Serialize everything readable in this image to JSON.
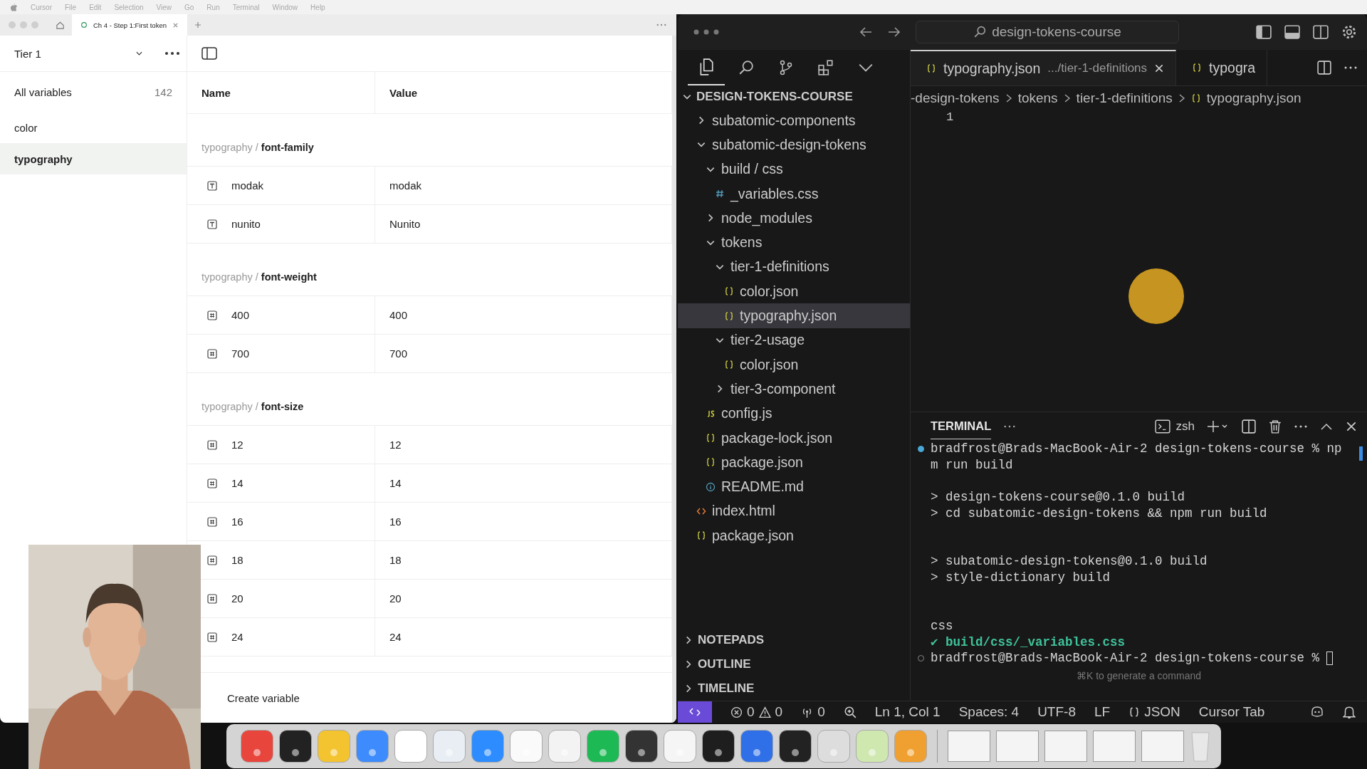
{
  "menu_bar": {
    "items": [
      "Cursor",
      "File",
      "Edit",
      "Selection",
      "View",
      "Go",
      "Run",
      "Terminal",
      "Window",
      "Help"
    ]
  },
  "variables_window": {
    "tab": {
      "title": "Ch 4 - Step 1:First token"
    },
    "collection": "Tier 1",
    "sidebar": {
      "all": {
        "label": "All variables",
        "count": "142"
      },
      "groups": [
        {
          "label": "color",
          "selected": false
        },
        {
          "label": "typography",
          "selected": true
        }
      ]
    },
    "columns": [
      "Name",
      "Value"
    ],
    "sections": [
      {
        "path": "typography /",
        "name": "font-family",
        "rows": [
          {
            "kind": "string",
            "name": "modak",
            "value": "modak"
          },
          {
            "kind": "string",
            "name": "nunito",
            "value": "Nunito"
          }
        ]
      },
      {
        "path": "typography /",
        "name": "font-weight",
        "rows": [
          {
            "kind": "number",
            "name": "400",
            "value": "400"
          },
          {
            "kind": "number",
            "name": "700",
            "value": "700"
          }
        ]
      },
      {
        "path": "typography /",
        "name": "font-size",
        "rows": [
          {
            "kind": "number",
            "name": "12",
            "value": "12"
          },
          {
            "kind": "number",
            "name": "14",
            "value": "14"
          },
          {
            "kind": "number",
            "name": "16",
            "value": "16"
          },
          {
            "kind": "number",
            "name": "18",
            "value": "18"
          },
          {
            "kind": "number",
            "name": "20",
            "value": "20"
          },
          {
            "kind": "number",
            "name": "24",
            "value": "24"
          }
        ]
      }
    ],
    "create_label": "Create variable"
  },
  "code_window": {
    "search": "design-tokens-course",
    "tabs": [
      {
        "label": "typography.json",
        "detail": ".../tier-1-definitions",
        "selected": true
      },
      {
        "label": "typogra",
        "selected": false
      }
    ],
    "breadcrumbs": [
      "-design-tokens",
      "tokens",
      "tier-1-definitions",
      "typography.json"
    ],
    "line_numbers": [
      "1"
    ],
    "explorer": {
      "title": "DESIGN-TOKENS-COURSE",
      "expanded": true,
      "items": [
        {
          "kind": "folder",
          "label": "subatomic-components",
          "expanded": false,
          "selected": false
        },
        {
          "kind": "folder",
          "label": "subatomic-design-tokens",
          "expanded": true,
          "selected": false,
          "children": [
            {
              "kind": "folder",
              "label": "build / css",
              "expanded": true,
              "selected": false,
              "children": [
                {
                  "kind": "css",
                  "label": "_variables.css",
                  "selected": false
                }
              ]
            },
            {
              "kind": "folder",
              "label": "node_modules",
              "expanded": false,
              "selected": false
            },
            {
              "kind": "folder",
              "label": "tokens",
              "expanded": true,
              "selected": false,
              "children": [
                {
                  "kind": "folder",
                  "label": "tier-1-definitions",
                  "expanded": true,
                  "selected": false,
                  "children": [
                    {
                      "kind": "json",
                      "label": "color.json",
                      "selected": false
                    },
                    {
                      "kind": "json",
                      "label": "typography.json",
                      "selected": true
                    }
                  ]
                },
                {
                  "kind": "folder",
                  "label": "tier-2-usage",
                  "expanded": true,
                  "selected": false,
                  "children": [
                    {
                      "kind": "json",
                      "label": "color.json",
                      "selected": false
                    }
                  ]
                },
                {
                  "kind": "folder",
                  "label": "tier-3-component",
                  "expanded": false,
                  "selected": false
                }
              ]
            },
            {
              "kind": "js",
              "label": "config.js",
              "selected": false
            },
            {
              "kind": "json",
              "label": "package-lock.json",
              "selected": false
            },
            {
              "kind": "json",
              "label": "package.json",
              "selected": false
            },
            {
              "kind": "info",
              "label": "README.md",
              "selected": false
            }
          ]
        },
        {
          "kind": "html",
          "label": "index.html",
          "selected": false
        },
        {
          "kind": "json",
          "label": "package.json",
          "selected": false
        }
      ]
    },
    "panels": [
      {
        "label": "NOTEPADS",
        "expanded": false
      },
      {
        "label": "OUTLINE",
        "expanded": false
      },
      {
        "label": "TIMELINE",
        "expanded": false
      }
    ],
    "terminal": {
      "title": "TERMINAL",
      "shell": "zsh",
      "lines": [
        {
          "kind": "prompt",
          "done": true,
          "text": "bradfrost@Brads-MacBook-Air-2 design-tokens-course % np"
        },
        {
          "kind": "output",
          "text": "m run build"
        },
        {
          "kind": "blank"
        },
        {
          "kind": "output",
          "text": "> design-tokens-course@0.1.0 build"
        },
        {
          "kind": "output",
          "text": "> cd subatomic-design-tokens && npm run build"
        },
        {
          "kind": "blank"
        },
        {
          "kind": "blank"
        },
        {
          "kind": "output",
          "text": "> subatomic-design-tokens@0.1.0 build"
        },
        {
          "kind": "output",
          "text": "> style-dictionary build"
        },
        {
          "kind": "blank"
        },
        {
          "kind": "blank"
        },
        {
          "kind": "output",
          "text": "css"
        },
        {
          "kind": "success",
          "text": "✔ build/css/_variables.css"
        },
        {
          "kind": "prompt",
          "done": false,
          "cursor": true,
          "text": "bradfrost@Brads-MacBook-Air-2 design-tokens-course %"
        }
      ],
      "hint": "⌘K to generate a command"
    },
    "status_bar": {
      "errors": "0",
      "warnings": "0",
      "ports": "0",
      "items": [
        "Ln 1, Col 1",
        "Spaces: 4",
        "UTF-8",
        "LF"
      ],
      "language": "JSON",
      "extra": "Cursor Tab"
    }
  }
}
